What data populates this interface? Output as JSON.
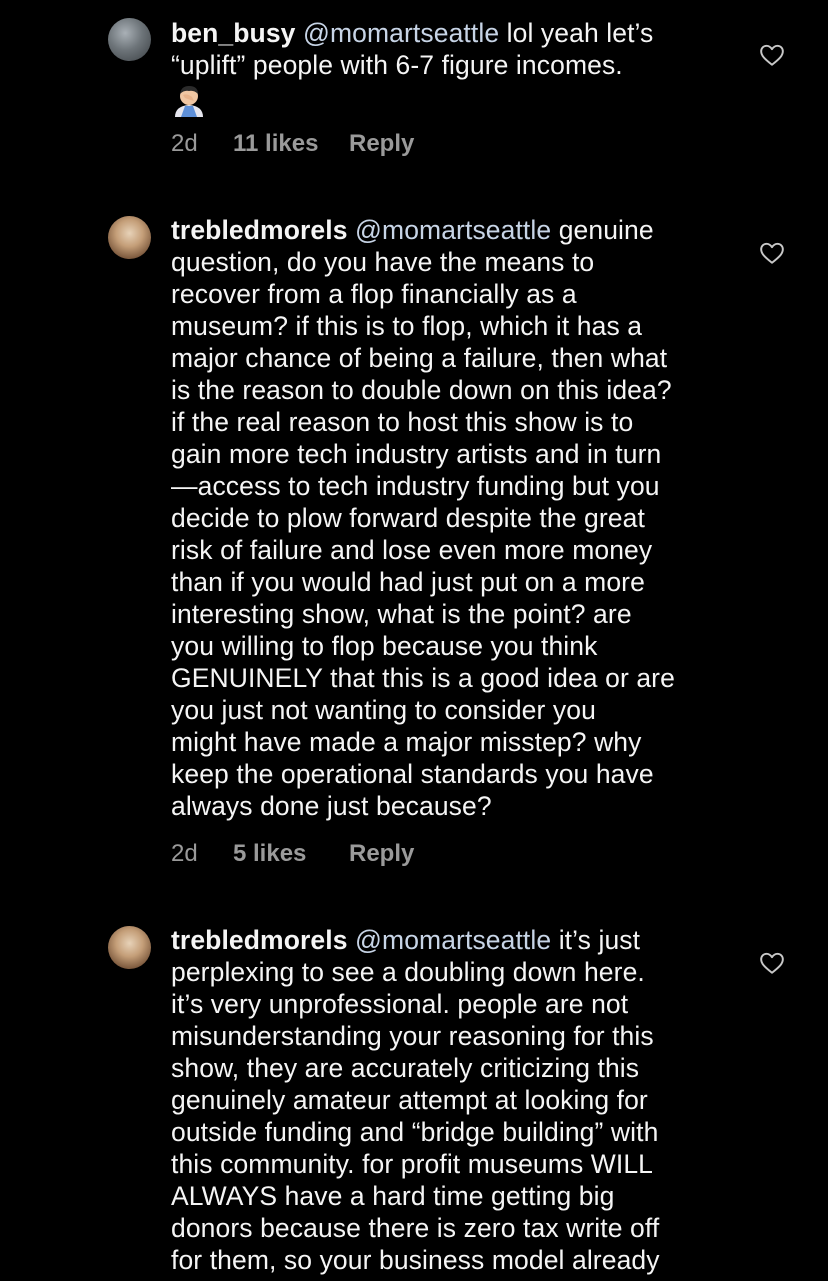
{
  "comments": [
    {
      "username": "ben_busy",
      "mention": "@momartseattle",
      "lines": [
        " lol yeah let’s",
        "“uplift” people with 6-7 figure incomes."
      ],
      "emoji_icon": "person-facepalming-emoji",
      "time": "2d",
      "likes": "11 likes",
      "reply": "Reply"
    },
    {
      "username": "trebledmorels",
      "mention": "@momartseattle",
      "lines": [
        " genuine",
        "question, do you have the means to",
        "recover from a flop financially as a",
        "museum? if this is to flop, which it has a",
        "major chance of being a failure, then what",
        "is the reason to double down on this idea?",
        "if the real reason to host this show is to",
        "gain more tech industry artists and in turn",
        "—access to tech industry funding but you",
        "decide to plow forward despite the great",
        "risk of failure and lose even more money",
        "than if you would had just put on a more",
        "interesting show, what is the point? are",
        "you willing to flop because you think",
        "GENUINELY that this is a good idea or are",
        "you just not wanting to consider you",
        "might have made a major misstep? why",
        "keep the operational standards you have",
        "always done just because?"
      ],
      "time": "2d",
      "likes": "5 likes",
      "reply": "Reply"
    },
    {
      "username": "trebledmorels",
      "mention": "@momartseattle",
      "lines": [
        " it’s just",
        "perplexing to see a doubling down here.",
        "it’s very unprofessional. people are not",
        "misunderstanding your reasoning for this",
        "show, they are accurately criticizing this",
        "genuinely amateur attempt at looking for",
        "outside funding and “bridge building” with",
        "this community. for profit museums WILL",
        "ALWAYS have a hard time getting big",
        "donors because there is zero tax write off",
        "for them, so your business model already"
      ]
    }
  ],
  "colors": {
    "background": "#000000",
    "text": "#f5f5f5",
    "mention": "#c7d4e6",
    "meta": "#9a9a9a"
  }
}
